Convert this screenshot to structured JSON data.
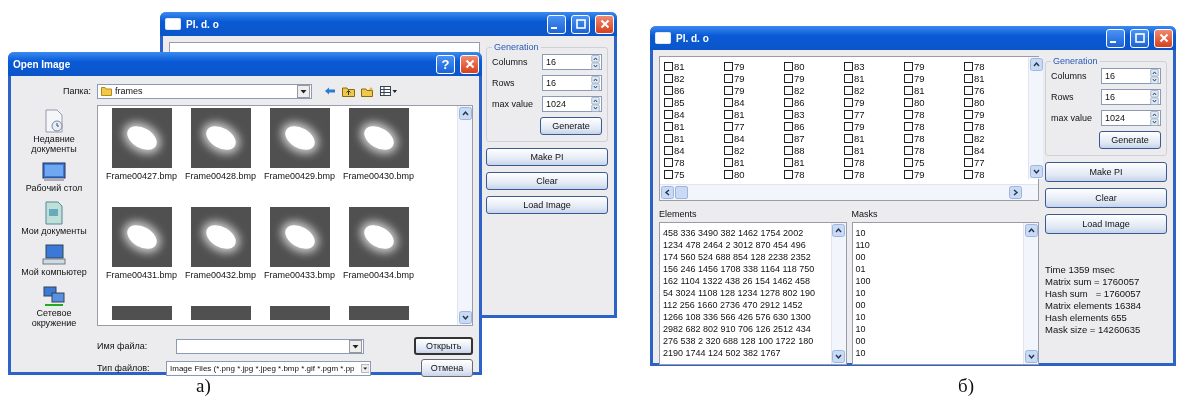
{
  "figure_a": {
    "main_window": {
      "title": "PI. d. o",
      "generation": {
        "title": "Generation",
        "fields": [
          {
            "label": "Columns",
            "value": "16"
          },
          {
            "label": "Rows",
            "value": "16"
          },
          {
            "label": "max value",
            "value": "1024"
          }
        ],
        "button": "Generate"
      },
      "buttons": [
        "Make PI",
        "Clear",
        "Load Image"
      ]
    },
    "open_dialog": {
      "title": "Open Image",
      "help": "?",
      "folder_label": "Папка:",
      "folder": "frames",
      "places": [
        {
          "kind": "recent",
          "label": "Недавние документы"
        },
        {
          "kind": "desktop",
          "label": "Рабочий стол"
        },
        {
          "kind": "documents",
          "label": "Мои документы"
        },
        {
          "kind": "computer",
          "label": "Мой компьютер"
        },
        {
          "kind": "network",
          "label": "Сетевое окружение"
        }
      ],
      "files": [
        {
          "kind": "thumbnail",
          "name": "Frame00427.bmp"
        },
        {
          "kind": "thumbnail",
          "name": "Frame00428.bmp"
        },
        {
          "kind": "thumbnail",
          "name": "Frame00429.bmp"
        },
        {
          "kind": "thumbnail",
          "name": "Frame00430.bmp"
        },
        {
          "kind": "thumbnail",
          "name": "Frame00431.bmp"
        },
        {
          "kind": "thumbnail",
          "name": "Frame00432.bmp"
        },
        {
          "kind": "thumbnail",
          "name": "Frame00433.bmp"
        },
        {
          "kind": "thumbnail",
          "name": "Frame00434.bmp"
        },
        {
          "kind": "cut-off"
        },
        {
          "kind": "cut-off"
        },
        {
          "kind": "cut-off"
        },
        {
          "kind": "cut-off"
        }
      ],
      "file_name_label": "Имя файла:",
      "file_type_label": "Тип файлов:",
      "file_type": "Image Files (*.png *.jpg *.jpeg *.bmp *.gif *.pgm *.pp",
      "buttons": [
        "Открыть",
        "Отмена"
      ]
    },
    "caption": "а)"
  },
  "figure_b": {
    "main_window": {
      "title": "PI. d. o",
      "grid": [
        [
          {
            "value": "81",
            "checked": false
          },
          {
            "value": "79",
            "checked": false
          },
          {
            "value": "80",
            "checked": false
          },
          {
            "value": "83",
            "checked": false
          },
          {
            "value": "79",
            "checked": false
          },
          {
            "value": "78",
            "checked": false
          }
        ],
        [
          {
            "value": "82",
            "checked": false
          },
          {
            "value": "79",
            "checked": false
          },
          {
            "value": "79",
            "checked": false
          },
          {
            "value": "81",
            "checked": false
          },
          {
            "value": "79",
            "checked": false
          },
          {
            "value": "81",
            "checked": false
          }
        ],
        [
          {
            "value": "86",
            "checked": false
          },
          {
            "value": "79",
            "checked": false
          },
          {
            "value": "82",
            "checked": false
          },
          {
            "value": "82",
            "checked": false
          },
          {
            "value": "81",
            "checked": false
          },
          {
            "value": "76",
            "checked": false
          }
        ],
        [
          {
            "value": "85",
            "checked": false
          },
          {
            "value": "84",
            "checked": false
          },
          {
            "value": "86",
            "checked": false
          },
          {
            "value": "79",
            "checked": false
          },
          {
            "value": "80",
            "checked": false
          },
          {
            "value": "80",
            "checked": false
          }
        ],
        [
          {
            "value": "84",
            "checked": false
          },
          {
            "value": "81",
            "checked": false
          },
          {
            "value": "83",
            "checked": false
          },
          {
            "value": "77",
            "checked": false
          },
          {
            "value": "78",
            "checked": false
          },
          {
            "value": "79",
            "checked": false
          }
        ],
        [
          {
            "value": "81",
            "checked": false
          },
          {
            "value": "77",
            "checked": false
          },
          {
            "value": "86",
            "checked": false
          },
          {
            "value": "79",
            "checked": false
          },
          {
            "value": "78",
            "checked": false
          },
          {
            "value": "78",
            "checked": false
          }
        ],
        [
          {
            "value": "81",
            "checked": false
          },
          {
            "value": "84",
            "checked": false
          },
          {
            "value": "87",
            "checked": false
          },
          {
            "value": "81",
            "checked": false
          },
          {
            "value": "78",
            "checked": false
          },
          {
            "value": "82",
            "checked": false
          }
        ],
        [
          {
            "value": "84",
            "checked": false
          },
          {
            "value": "82",
            "checked": false
          },
          {
            "value": "88",
            "checked": false
          },
          {
            "value": "81",
            "checked": false
          },
          {
            "value": "78",
            "checked": false
          },
          {
            "value": "84",
            "checked": false
          }
        ],
        [
          {
            "value": "78",
            "checked": false
          },
          {
            "value": "81",
            "checked": false
          },
          {
            "value": "81",
            "checked": false
          },
          {
            "value": "78",
            "checked": false
          },
          {
            "value": "75",
            "checked": false
          },
          {
            "value": "77",
            "checked": false
          }
        ],
        [
          {
            "value": "75",
            "checked": false
          },
          {
            "value": "80",
            "checked": false
          },
          {
            "value": "78",
            "checked": false
          },
          {
            "value": "78",
            "checked": false
          },
          {
            "value": "79",
            "checked": false
          },
          {
            "value": "78",
            "checked": false
          }
        ]
      ],
      "elements_label": "Elements",
      "elements": [
        "458 336 3490 382 1462 1754 2002",
        "1234 478 2464 2 3012 870 454 496",
        "174 560 524 688 854 128 2238 2352",
        "156 246 1456 1708 338 1164 118 750",
        "162 1104 1322 438 26 154 1462 458",
        "54 3024 1108 128 1234 1278 802 190",
        "112 256 1660 2736 470 2912 1452",
        "1266 108 336 566 426 576 630 1300",
        "2982 682 802 910 706 126 2512 434",
        "276 538 2 320 688 128 100 1722 180",
        "2190 1744 124 502 382 1767"
      ],
      "masks_label": "Masks",
      "masks": [
        "10",
        "110",
        "00",
        "01",
        "100",
        "10",
        "00",
        "10",
        "10",
        "00",
        "10"
      ],
      "generation": {
        "title": "Generation",
        "fields": [
          {
            "label": "Columns",
            "value": "16"
          },
          {
            "label": "Rows",
            "value": "16"
          },
          {
            "label": "max value",
            "value": "1024"
          }
        ],
        "button": "Generate"
      },
      "buttons": [
        "Make PI",
        "Clear",
        "Load Image"
      ],
      "stats": [
        "Time 1359 msec",
        "Matrix sum = 1760057",
        "Hash sum   = 1760057",
        "Matrix elements 16384",
        "Hash elements 655",
        "Mask size = 14260635"
      ]
    },
    "caption": "б)"
  }
}
